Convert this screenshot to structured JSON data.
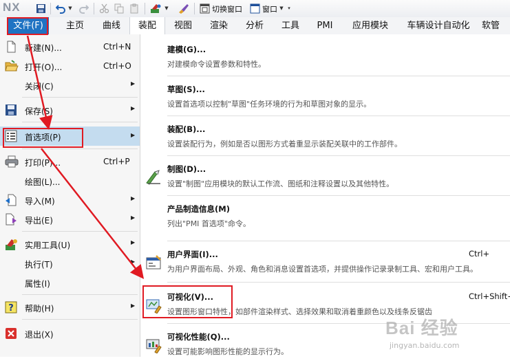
{
  "toolbar": {
    "app_logo": "NX",
    "switch_window_label": "切换窗口",
    "window_label": "窗口"
  },
  "ribbon_tabs": {
    "file": "文件(F)",
    "tabs": [
      "主页",
      "曲线",
      "装配",
      "视图",
      "渲染",
      "分析",
      "工具",
      "PMI",
      "应用模块",
      "车辆设计自动化",
      "软管"
    ],
    "active_index": 2
  },
  "file_menu": {
    "items": [
      {
        "label": "新建(N)...",
        "shortcut": "Ctrl+N",
        "submenu": false
      },
      {
        "label": "打开(O)...",
        "shortcut": "Ctrl+O",
        "submenu": false
      },
      {
        "label": "关闭(C)",
        "shortcut": "",
        "submenu": true
      },
      {
        "label": "保存(S)",
        "shortcut": "",
        "submenu": true
      },
      {
        "label": "首选项(P)",
        "shortcut": "",
        "submenu": true
      },
      {
        "label": "打印(P)...",
        "shortcut": "Ctrl+P",
        "submenu": false
      },
      {
        "label": "绘图(L)...",
        "shortcut": "",
        "submenu": false
      },
      {
        "label": "导入(M)",
        "shortcut": "",
        "submenu": true
      },
      {
        "label": "导出(E)",
        "shortcut": "",
        "submenu": true
      },
      {
        "label": "实用工具(U)",
        "shortcut": "",
        "submenu": true
      },
      {
        "label": "执行(T)",
        "shortcut": "",
        "submenu": true
      },
      {
        "label": "属性(I)",
        "shortcut": "",
        "submenu": false
      },
      {
        "label": "帮助(H)",
        "shortcut": "",
        "submenu": true
      },
      {
        "label": "退出(X)",
        "shortcut": "",
        "submenu": false
      }
    ],
    "highlighted_index": 4
  },
  "preferences_menu": {
    "items": [
      {
        "title": "建模(G)...",
        "desc": "对建模命令设置参数和特性。",
        "shortcut": ""
      },
      {
        "title": "草图(S)...",
        "desc": "设置首选项以控制\"草图\"任务环境的行为和草图对象的显示。",
        "shortcut": ""
      },
      {
        "title": "装配(B)...",
        "desc": "设置装配行为，例如是否以图形方式着重显示装配关联中的工作部件。",
        "shortcut": ""
      },
      {
        "title": "制图(D)...",
        "desc": "设置\"制图\"应用模块的默认工作流、图纸和注释设置以及其他特性。",
        "shortcut": ""
      },
      {
        "title": "产品制造信息(M)",
        "desc": "列出\"PMI 首选项\"命令。",
        "shortcut": ""
      },
      {
        "title": "用户界面(I)...",
        "desc": "为用户界面布局、外观、角色和消息设置首选项，并提供操作记录录制工具、宏和用户工具。",
        "shortcut": "Ctrl+"
      },
      {
        "title": "可视化(V)...",
        "desc": "设置图形窗口特性，如部件渲染样式、选择效果和取消着重颜色以及线条反锯齿",
        "shortcut": "Ctrl+Shift+V"
      },
      {
        "title": "可视化性能(Q)...",
        "desc": "设置可能影响图形性能的显示行为。",
        "shortcut": ""
      }
    ]
  },
  "watermark": {
    "main": "Bai 经验",
    "sub": "jingyan.baidu.com"
  },
  "colors": {
    "file_tab_bg": "#1f73c3",
    "highlight_bg": "#c4dcef",
    "annotation_red": "#e01a22"
  }
}
